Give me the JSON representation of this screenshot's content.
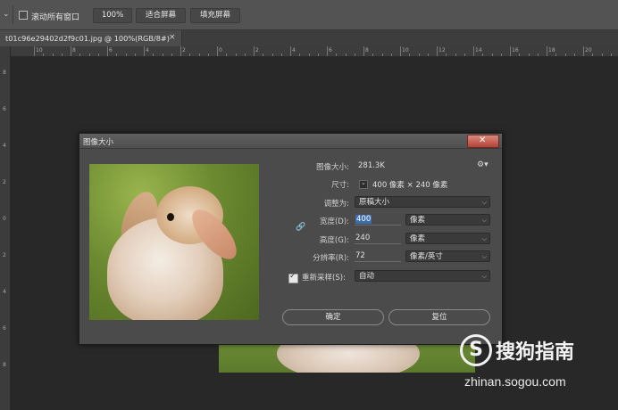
{
  "options_bar": {
    "scroll_all_label": "滚动所有窗口",
    "zoom_100_label": "100%",
    "fit_screen_label": "适合屏幕",
    "fill_screen_label": "填充屏幕"
  },
  "document_tab": {
    "title": "t01c96e29402d2f9c01.jpg @ 100%(RGB/8#)",
    "close": "×"
  },
  "ruler": {
    "top_labels": [
      "10",
      "8",
      "6",
      "4",
      "2",
      "0",
      "2",
      "4",
      "6",
      "8",
      "10",
      "12",
      "14",
      "16",
      "18",
      "20"
    ],
    "left_labels": [
      "8",
      "6",
      "4",
      "2",
      "0",
      "2",
      "4",
      "6",
      "8"
    ]
  },
  "dialog": {
    "title": "图像大小",
    "image_size_label": "图像大小:",
    "image_size_value": "281.3K",
    "dimensions_label": "尺寸:",
    "dimensions_value": "400 像素 × 240 像素",
    "fit_to_label": "调整为:",
    "fit_to_value": "原稿大小",
    "width_label": "宽度(D):",
    "width_value": "400",
    "width_unit": "像素",
    "height_label": "高度(G):",
    "height_value": "240",
    "height_unit": "像素",
    "resolution_label": "分辨率(R):",
    "resolution_value": "72",
    "resolution_unit": "像素/英寸",
    "resample_label": "重新采样(S):",
    "resample_value": "自动",
    "ok_label": "确定",
    "reset_label": "复位"
  },
  "watermark": {
    "brand": "搜狗指南",
    "url": "zhinan.sogou.com"
  },
  "colors": {
    "app_bg": "#282828",
    "panel": "#535353",
    "dialog": "#4b4b4b",
    "selection": "#3d6fb0"
  }
}
